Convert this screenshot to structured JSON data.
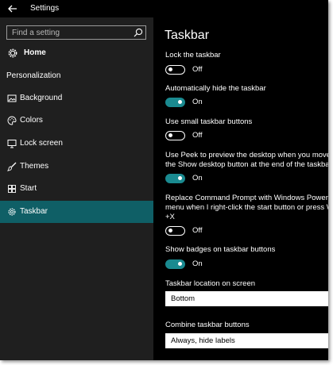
{
  "titlebar": {
    "title": "Settings",
    "back_icon": "arrow-left-icon"
  },
  "sidebar": {
    "search": {
      "placeholder": "Find a setting",
      "icon": "search-icon"
    },
    "home": {
      "label": "Home",
      "icon": "gear-icon"
    },
    "section_title": "Personalization",
    "items": [
      {
        "label": "Background",
        "icon": "picture-icon"
      },
      {
        "label": "Colors",
        "icon": "palette-icon"
      },
      {
        "label": "Lock screen",
        "icon": "monitor-icon"
      },
      {
        "label": "Themes",
        "icon": "brush-icon"
      },
      {
        "label": "Start",
        "icon": "grid-icon"
      },
      {
        "label": "Taskbar",
        "icon": "taskbar-icon",
        "selected": true
      }
    ]
  },
  "main": {
    "title": "Taskbar",
    "settings": [
      {
        "label": "Lock the taskbar",
        "state": "Off"
      },
      {
        "label": "Automatically hide the taskbar",
        "state": "On"
      },
      {
        "label": "Use small taskbar buttons",
        "state": "Off"
      },
      {
        "label_line1": "Use Peek to preview the desktop when you move your",
        "label_line2": "the Show desktop button at the end of the taskbar",
        "state": "On"
      },
      {
        "label_line1": "Replace Command Prompt with Windows PowerShell",
        "label_line2": "menu when I right-click the start button or press W",
        "label_line3": "+X",
        "state": "Off"
      },
      {
        "label": "Show badges on taskbar buttons",
        "state": "On"
      }
    ],
    "location": {
      "label": "Taskbar location on screen",
      "value": "Bottom"
    },
    "combine": {
      "label": "Combine taskbar buttons",
      "value": "Always, hide labels"
    }
  },
  "colors": {
    "accent": "#1a8a90",
    "selected_nav": "#0f5f66",
    "sidebar_bg": "#1f1f1f",
    "content_bg": "#000000"
  }
}
